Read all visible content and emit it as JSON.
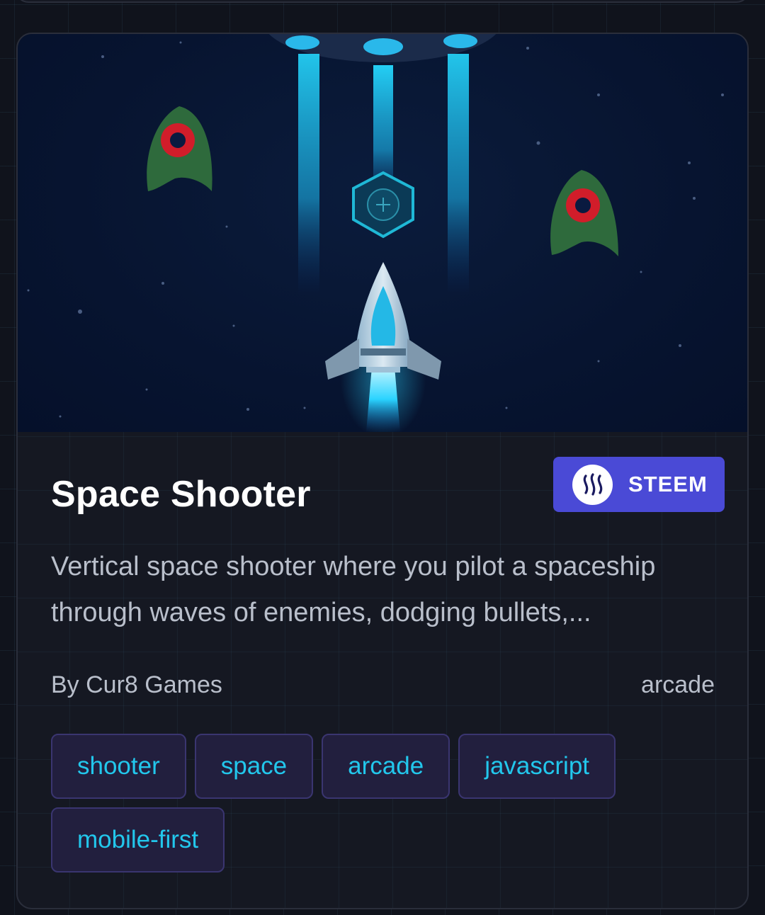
{
  "game": {
    "title": "Space Shooter",
    "chain": "STEEM",
    "description": "Vertical space shooter where you pilot a spaceship through waves of enemies, dodging bullets,...",
    "author": "By Cur8 Games",
    "genre": "arcade",
    "tags": [
      "shooter",
      "space",
      "arcade",
      "javascript",
      "mobile-first"
    ]
  },
  "colors": {
    "background": "#10131c",
    "card": "#161922",
    "chain_badge": "#4a4ad6",
    "tag_bg": "#221f3e",
    "tag_text": "#22c7ec",
    "title_text": "#ffffff",
    "body_text": "#b9bfcb"
  },
  "icons": {
    "chain_logo": "steem-logo-icon"
  }
}
